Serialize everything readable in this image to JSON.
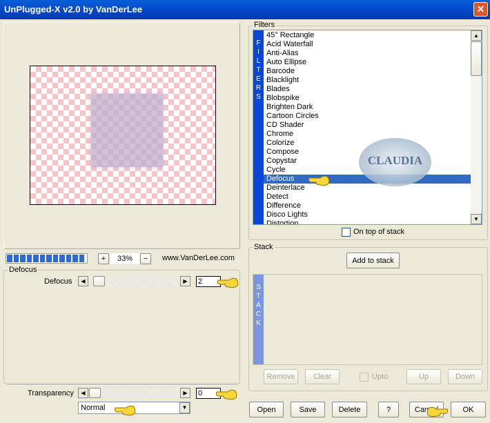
{
  "window": {
    "title": "UnPlugged-X v2.0 by VanDerLee",
    "close": "✕"
  },
  "preview": {
    "zoom": "33%",
    "zoom_in": "+",
    "zoom_out": "−",
    "url": "www.VanDerLee.com",
    "progress_percent": 100
  },
  "defocus_group": {
    "title": "Defocus",
    "param_label": "Defocus",
    "param_value": "2"
  },
  "transparency": {
    "label": "Transparency",
    "value": "0",
    "blend_mode": "Normal"
  },
  "filters": {
    "title": "Filters",
    "strip_label": "FILTERS",
    "selected": "Defocus",
    "items": [
      "45° Rectangle",
      "Acid Waterfall",
      "Anti-Alias",
      "Auto Ellipse",
      "Barcode",
      "Blacklight",
      "Blades",
      "Blobspike",
      "Brighten Dark",
      "Cartoon Circles",
      "CD Shader",
      "Chrome",
      "Colorize",
      "Compose",
      "Copystar",
      "Cycle",
      "Defocus",
      "Deinterlace",
      "Detect",
      "Difference",
      "Disco Lights",
      "Distortion"
    ],
    "on_top_label": "On top of stack",
    "on_top_checked": false
  },
  "stack": {
    "title": "Stack",
    "add_label": "Add to stack",
    "strip_label": "STACK",
    "remove": "Remove",
    "clear": "Clear",
    "upto": "Upto",
    "up": "Up",
    "down": "Down"
  },
  "footer": {
    "open": "Open",
    "save": "Save",
    "delete": "Delete",
    "help": "?",
    "cancel": "Cancel",
    "ok": "OK"
  },
  "watermark": {
    "text": "CLAUDIA"
  },
  "colors": {
    "title_bar": "#0a5fd8",
    "selection": "#316ac5",
    "filter_strip": "#0a46d6",
    "stack_strip": "#7a96df",
    "checker_pink": "#f7c4c8"
  }
}
